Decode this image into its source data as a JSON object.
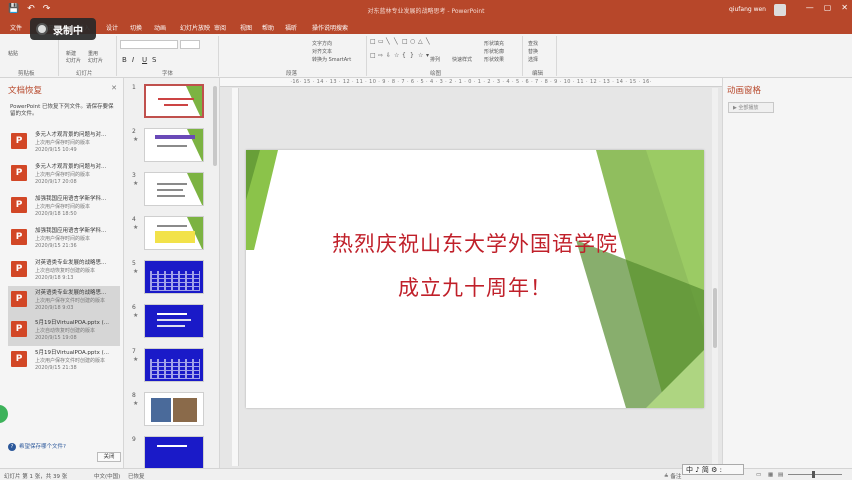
{
  "titlebar": {
    "qat": [
      "💾",
      "↶",
      "↷"
    ],
    "title": "对东蓝林专业发展的战略思考 - PowerPoint",
    "user": "qiufang wen",
    "window_buttons": [
      "—",
      "▢",
      "✕"
    ]
  },
  "recording": {
    "label": "录制中"
  },
  "menu": [
    "文件",
    "开始",
    "插入",
    "设计",
    "切换",
    "动画",
    "幻灯片放映",
    "审阅",
    "视图",
    "帮助",
    "福昕",
    "操作说明搜索"
  ],
  "ribbon": {
    "groups": [
      "剪贴板",
      "幻灯片",
      "字体",
      "段落",
      "绘图",
      "编辑"
    ],
    "paste": "粘贴",
    "new_slide": "新建\n幻灯片",
    "reuse": "重用\n幻灯片",
    "shape_fill": "形状填充",
    "shape_outline": "形状轮廓",
    "shape_effect": "形状效果",
    "arrange": "排列",
    "quick_styles": "快速样式",
    "find": "查找",
    "replace": "替换",
    "select": "选择",
    "text_direction": "文字方向",
    "align_text": "对齐文本",
    "smartart": "转换为 SmartArt"
  },
  "recovery": {
    "title": "文档恢复",
    "desc": "PowerPoint 已恢复下列文件。请保存要保留的文件。",
    "items": [
      {
        "name": "多元人才观背景的问题与对...",
        "sub": "上次用户保存时间的版本",
        "date": "2020/9/15 10:49"
      },
      {
        "name": "多元人才观背景的问题与对...",
        "sub": "上次用户保存时间的版本",
        "date": "2020/9/17 20:08"
      },
      {
        "name": "加强我国应用语言学新学科...",
        "sub": "上次用户保存时间的版本",
        "date": "2020/9/18 18:50"
      },
      {
        "name": "加强我国应用语言学新学科...",
        "sub": "上次用户保存时间的版本",
        "date": "2020/9/15 21:36"
      },
      {
        "name": "对英语类专业发展的战略思...",
        "sub": "上次自动恢复时创建的版本",
        "date": "2020/9/18 9:13"
      },
      {
        "name": "对英语类专业发展的战略思...",
        "sub": "上次用户保存文件时创建的版本",
        "date": "2020/9/18 9:03"
      },
      {
        "name": "5月19日VirtualPOA.pptx (...",
        "sub": "上次自动恢复时创建的版本",
        "date": "2020/9/15 19:08"
      },
      {
        "name": "5月19日VirtualPOA.pptx (...",
        "sub": "上次用户保存文件时创建的版本",
        "date": "2020/9/15 21:38"
      }
    ],
    "help": "希望保存哪个文件?",
    "close_button": "关闭"
  },
  "slides": [
    "1",
    "2",
    "3",
    "4",
    "5",
    "6",
    "7",
    "8",
    "9"
  ],
  "slide": {
    "line1": "热烈庆祝山东大学外国语学院",
    "line2": "成立九十周年！"
  },
  "ruler": "·16· 15 · 14 · 13 · 12 · 11 · 10 · 9 · 8 · 7 · 6 · 5 · 4 · 3 · 2 · 1 · 0 · 1 · 2 · 3 · 4 · 5 · 6 · 7 · 8 · 9 · 10 · 11 · 12 · 13 · 14 · 15 · 16·",
  "animation_pane": {
    "title": "动画窗格",
    "play": "▶ 全部播放"
  },
  "status": {
    "slide_info": "幻灯片 第 1 张，共 39 张",
    "language": "中文(中国)",
    "recovered": "已恢复",
    "notes": "≜ 备注",
    "ime": "中 ♪ 简 ⚙ :"
  },
  "colors": {
    "accent": "#b7472a",
    "slide_text": "#c0202a",
    "green": "#7cb342"
  }
}
